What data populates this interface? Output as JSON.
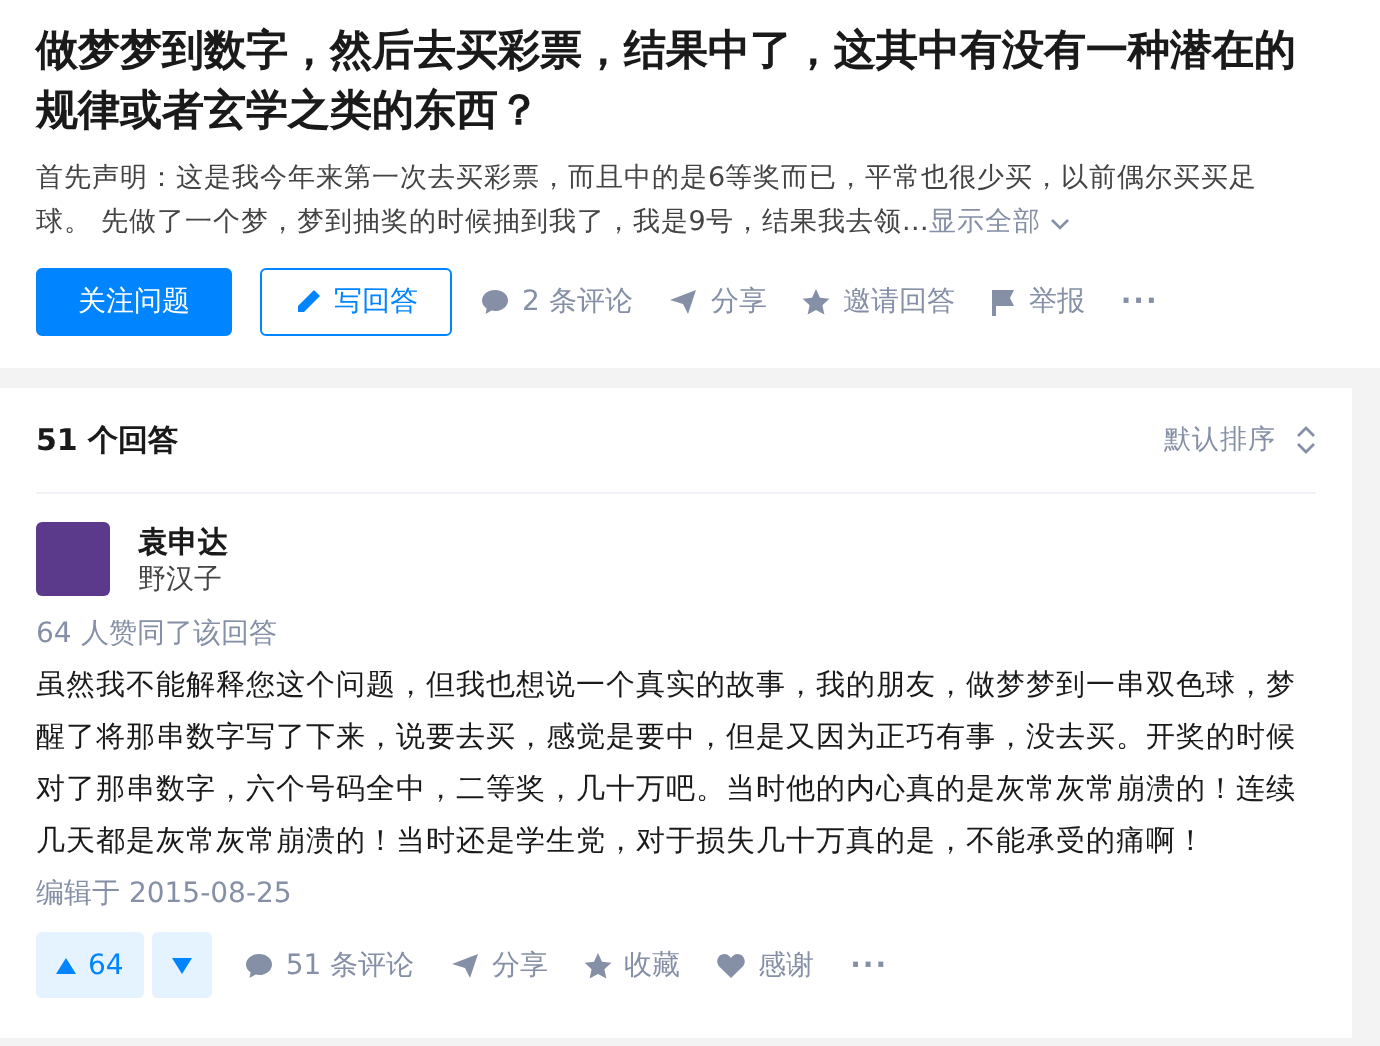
{
  "question": {
    "title": "做梦梦到数字，然后去买彩票，结果中了，这其中有没有一种潜在的规律或者玄学之类的东西？",
    "excerpt": "首先声明：这是我今年来第一次去买彩票，而且中的是6等奖而已，平常也很少买，以前偶尔买买足球。 先做了一个梦，梦到抽奖的时候抽到我了，我是9号，结果我去领…",
    "show_all": "显示全部",
    "follow_button": "关注问题",
    "answer_button": "写回答",
    "actions": [
      {
        "kind": "comment",
        "label": "2 条评论"
      },
      {
        "kind": "share",
        "label": "分享"
      },
      {
        "kind": "invite",
        "label": "邀请回答"
      },
      {
        "kind": "report",
        "label": "举报"
      },
      {
        "kind": "more",
        "label": "···"
      }
    ]
  },
  "answers": {
    "count": "51 个回答",
    "sort": "默认排序",
    "answer": {
      "author": "袁申达",
      "bio": "野汉子",
      "votes_note": "64 人赞同了该回答",
      "body": "虽然我不能解释您这个问题，但我也想说一个真实的故事，我的朋友，做梦梦到一串双色球，梦醒了将那串数字写了下来，说要去买，感觉是要中，但是又因为正巧有事，没去买。开奖的时候对了那串数字，六个号码全中，二等奖，几十万吧。当时他的内心真的是灰常灰常崩溃的！连续几天都是灰常灰常崩溃的！当时还是学生党，对于损失几十万真的是，不能承受的痛啊！",
      "edited": "编辑于 2015-08-25",
      "upvotes": "64",
      "actions": [
        {
          "kind": "comment",
          "label": "51 条评论"
        },
        {
          "kind": "share",
          "label": "分享"
        },
        {
          "kind": "collect",
          "label": "收藏"
        },
        {
          "kind": "thanks",
          "label": "感谢"
        },
        {
          "kind": "more",
          "label": "···"
        }
      ]
    }
  }
}
